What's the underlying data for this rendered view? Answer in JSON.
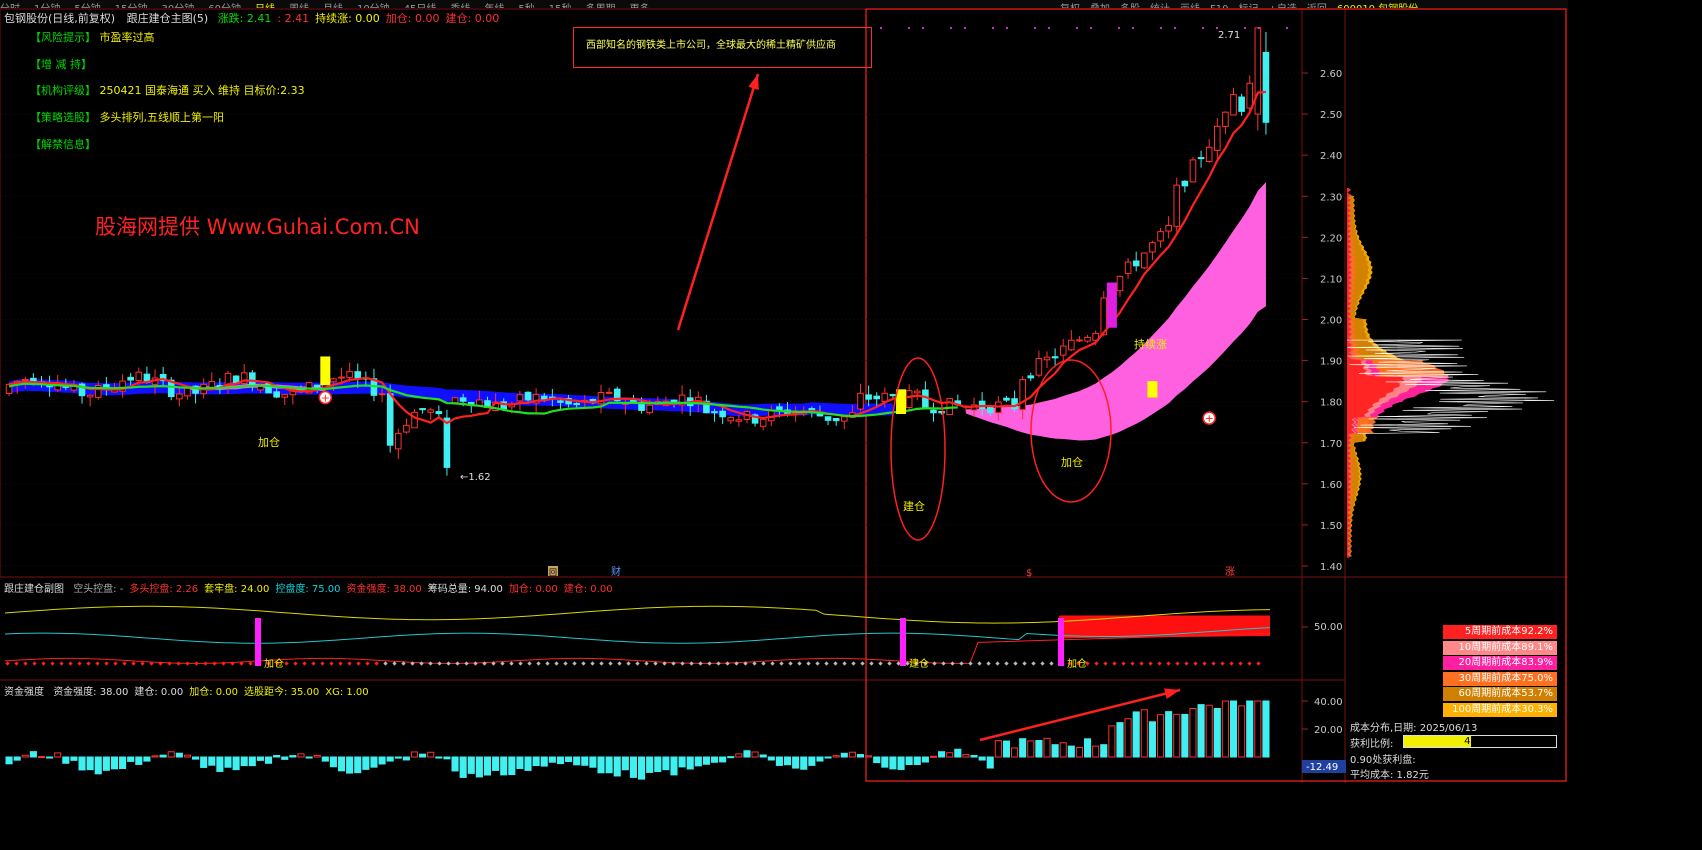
{
  "header": {
    "tabs": [
      "分时",
      "1分钟",
      "5分钟",
      "15分钟",
      "30分钟",
      "60分钟",
      "日线",
      "周线",
      "月线",
      "10分钟",
      "45日线",
      "季线",
      "年线",
      "5秒",
      "15秒",
      "多周期",
      "更多"
    ],
    "right_buttons": [
      "复权",
      "叠加",
      "多股",
      "统计",
      "画线",
      "F10",
      "标记",
      "+自选",
      "返回"
    ],
    "stock_code": "600010",
    "stock_name": "包钢股份"
  },
  "main_title": {
    "name": "包钢股份(日线,前复权)",
    "indicator": "跟庄建仓主图(5)",
    "items": [
      {
        "label": "涨跌: 2.41",
        "color": "#00e000"
      },
      {
        "label": ": 2.41",
        "color": "#ff3030"
      },
      {
        "label": "持续涨: 0.00",
        "color": "#f0f000"
      },
      {
        "label": "加仓: 0.00",
        "color": "#ff3030"
      },
      {
        "label": "建仓: 0.00",
        "color": "#ff3030"
      }
    ]
  },
  "info_lines": [
    {
      "tag": "【风险提示】",
      "value": "市盈率过高"
    },
    {
      "tag": "【增 减 持】",
      "value": ""
    },
    {
      "tag": "【机构评级】",
      "value": "250421 国泰海通 买入 维持 目标价:2.33"
    },
    {
      "tag": "【策略选股】",
      "value": "多头排列,五线顺上第一阳"
    },
    {
      "tag": "【解禁信息】",
      "value": ""
    }
  ],
  "annotation_box": "西部知名的钢铁类上市公司，全球最大的稀土精矿供应商",
  "watermark": "股海网提供 Www.Guhai.Com.CN",
  "chart_labels": {
    "jiacang1": "加仓",
    "jiancang": "建仓",
    "jiacang2": "加仓",
    "chixuzhang": "持续涨",
    "high_label": "2.71",
    "low_label": "1.62",
    "cai_marker": "财",
    "hui_marker": "回",
    "zhang_marker": "涨"
  },
  "sub1": {
    "title": "跟庄建仓副图",
    "items": [
      {
        "label": "空头控盘: -",
        "color": "#aaaaaa"
      },
      {
        "label": "多头控盘: 2.26",
        "color": "#ff3030"
      },
      {
        "label": "套牢盘: 24.00",
        "color": "#f0f000"
      },
      {
        "label": "控盘度: 75.00",
        "color": "#00d8e0"
      },
      {
        "label": "资金强度: 38.00",
        "color": "#ff3030"
      },
      {
        "label": "筹码总量: 94.00",
        "color": "#dddddd"
      },
      {
        "label": "加仓: 0.00",
        "color": "#ff3030"
      },
      {
        "label": "建仓: 0.00",
        "color": "#ff3030"
      }
    ],
    "axis_label": "50.00",
    "mark_labels": [
      "加仓",
      "建仓",
      "加仓"
    ]
  },
  "sub2": {
    "title": "资金强度",
    "items": [
      {
        "label": "资金强度: 38.00",
        "color": "#dddddd"
      },
      {
        "label": "建仓: 0.00",
        "color": "#dddddd"
      },
      {
        "label": "加仓: 0.00",
        "color": "#f0f000"
      },
      {
        "label": "选股距今: 35.00",
        "color": "#f0f000"
      },
      {
        "label": "XG: 1.00",
        "color": "#f0f000"
      }
    ],
    "axis_labels": [
      "40.00",
      "20.00"
    ],
    "current_value": "-12.49"
  },
  "cost_distribution": {
    "rows": [
      {
        "label": "5周期前成本92.2%",
        "color": "#ff2020"
      },
      {
        "label": "10周期前成本89.1%",
        "color": "#ff8888"
      },
      {
        "label": "20周期前成本83.9%",
        "color": "#ff20a0"
      },
      {
        "label": "30周期前成本75.0%",
        "color": "#ff7020"
      },
      {
        "label": "60周期前成本53.7%",
        "color": "#d08000"
      },
      {
        "label": "100周期前成本30.3%",
        "color": "#ffb000"
      }
    ],
    "date_line": "成本分布,日期:  2025/06/13",
    "profit_label": "获利比例:",
    "profit_value": "44.2%",
    "profit_fraction": 0.442,
    "line3": "0.90处获利盘:",
    "avg_cost": "平均成本:  1.82元"
  },
  "chart_data": [
    {
      "type": "candlestick",
      "title": "包钢股份(日线,前复权)",
      "y_ticks": [
        2.6,
        2.5,
        2.4,
        2.3,
        2.2,
        2.1,
        2.0,
        1.9,
        1.8,
        1.7,
        1.6,
        1.5,
        1.4
      ],
      "ylim": [
        1.38,
        2.75
      ],
      "high": 2.71,
      "low": 1.62,
      "last_close": 2.41,
      "grid": true
    },
    {
      "type": "line",
      "title": "跟庄建仓副图",
      "y_ticks": [
        50.0
      ]
    },
    {
      "type": "bar",
      "title": "资金强度",
      "y_ticks": [
        40.0,
        20.0
      ],
      "last_value": 38.0
    }
  ]
}
